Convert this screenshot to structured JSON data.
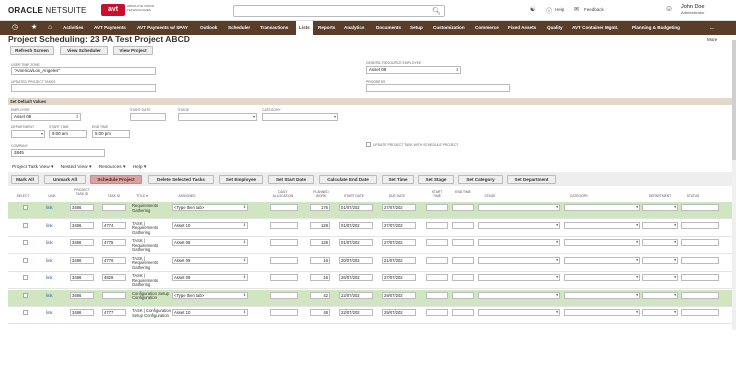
{
  "header": {
    "brand_oracle": "ORACLE",
    "brand_netsuite": "NETSUITE",
    "brand_avt": "avt",
    "brand_avt_sub": "ABSOLUTE VISION TECHNOLOGIES",
    "help": "Help",
    "feedback": "Feedback",
    "user_name": "John Doe",
    "user_role": "Administrator"
  },
  "nav": {
    "items": [
      "Activities",
      "AVT Payments",
      "AVT Payments w/ SPAY",
      "Outlook",
      "Scheduler",
      "Transactions",
      "Lists",
      "Reports",
      "Analytics",
      "Documents",
      "Setup",
      "Customization",
      "Commerce",
      "Fixed Assets",
      "Quality",
      "AVT Container Mgmt.",
      "Planning & Budgeting",
      "..."
    ],
    "active": "Lists"
  },
  "page": {
    "title": "Project Scheduling: 23 PA Test Project ABCD",
    "more": "More"
  },
  "buttons": {
    "refresh": "Refresh Screen",
    "view_scheduler": "View Scheduler",
    "view_project": "View Project"
  },
  "form": {
    "user_tz_label": "USER TIME ZONE",
    "user_tz_value": "\"America/Los_Angeles\"",
    "updated_tasks_label": "UPDATED PROJECT TASKS",
    "generic_resource_label": "GENERIC RESOURCE EMPLOYEE",
    "generic_resource_value": "Asset 08",
    "progress_label": "PROGRESS"
  },
  "defaults": {
    "section_title": "Set Default Values",
    "employee_label": "EMPLOYEE",
    "employee_value": "Asset 08",
    "start_date_label": "START DATE",
    "stage_label": "STAGE",
    "category_label": "CATEGORY",
    "department_label": "DEPARTMENT",
    "start_time_label": "START TIME",
    "start_time_value": "9:00 am",
    "end_time_label": "END TIME",
    "end_time_value": "5:00 pm",
    "company_label": "COMPANY",
    "company_value": "3845",
    "update_chk_label": "UPDATE PROJECT TASK WITH SCHEDULE PROJECT"
  },
  "sublinks": [
    "Project Task View ▾",
    "Nested View ▾",
    "Resources ▾",
    "Help ▾"
  ],
  "toolbar": [
    "Mark All",
    "Unmark All",
    "Schedule Project",
    "Delete Selected Tasks",
    "Set Employee",
    "Set Start Date",
    "Calculate End Date",
    "Set Time",
    "Set Stage",
    "Set Category",
    "Set Department"
  ],
  "grid": {
    "headers": [
      "SELECT",
      "LINK",
      "PROJECT TASK ID",
      "TASK ID",
      "TITLE ▾",
      "ASSIGNED",
      "DAILY ALLOCATION",
      "PLANNED WORK",
      "START DATE",
      "DUE DATE",
      "START TIME",
      "END TIME",
      "STAGE",
      "CATEGORY",
      "DEPARTMENT",
      "STATUS"
    ],
    "rows": [
      {
        "link": "link",
        "project_task_id": "3486",
        "task_id": "",
        "title": "Requirements Gathering",
        "assigned": "<Type then tab>",
        "planned": "176",
        "start": "01/07/202",
        "due": "27/07/202",
        "hl": true
      },
      {
        "link": "link",
        "project_task_id": "3486",
        "task_id": "4774",
        "title": "TASK | Requirements Gathering",
        "assigned": "Asset 10",
        "planned": "128",
        "start": "01/07/202",
        "due": "27/07/202",
        "hl": false
      },
      {
        "link": "link",
        "project_task_id": "3486",
        "task_id": "4775",
        "title": "TASK | Requirements Gathering",
        "assigned": "Asset 08",
        "planned": "128",
        "start": "01/07/202",
        "due": "27/07/202",
        "hl": false
      },
      {
        "link": "link",
        "project_task_id": "3486",
        "task_id": "4776",
        "title": "TASK | Requirements Gathering",
        "assigned": "Asset 09",
        "planned": "16",
        "start": "20/07/202",
        "due": "21/07/202",
        "hl": false
      },
      {
        "link": "link",
        "project_task_id": "3486",
        "task_id": "4829",
        "title": "TASK | Requirements Gathering",
        "assigned": "Asset 09",
        "planned": "16",
        "start": "26/07/202",
        "due": "27/07/202",
        "hl": false
      },
      {
        "link": "link",
        "project_task_id": "3486",
        "task_id": "",
        "title": "Configuration Setup Configuration",
        "assigned": "<Type then tab>",
        "planned": "42",
        "start": "22/07/202",
        "due": "29/07/202",
        "hl": true
      },
      {
        "link": "link",
        "project_task_id": "3486",
        "task_id": "4777",
        "title": "TASK | Configuration Setup Configuration",
        "assigned": "Asset 10",
        "planned": "48",
        "start": "22/07/202",
        "due": "29/07/202",
        "hl": false
      }
    ]
  }
}
